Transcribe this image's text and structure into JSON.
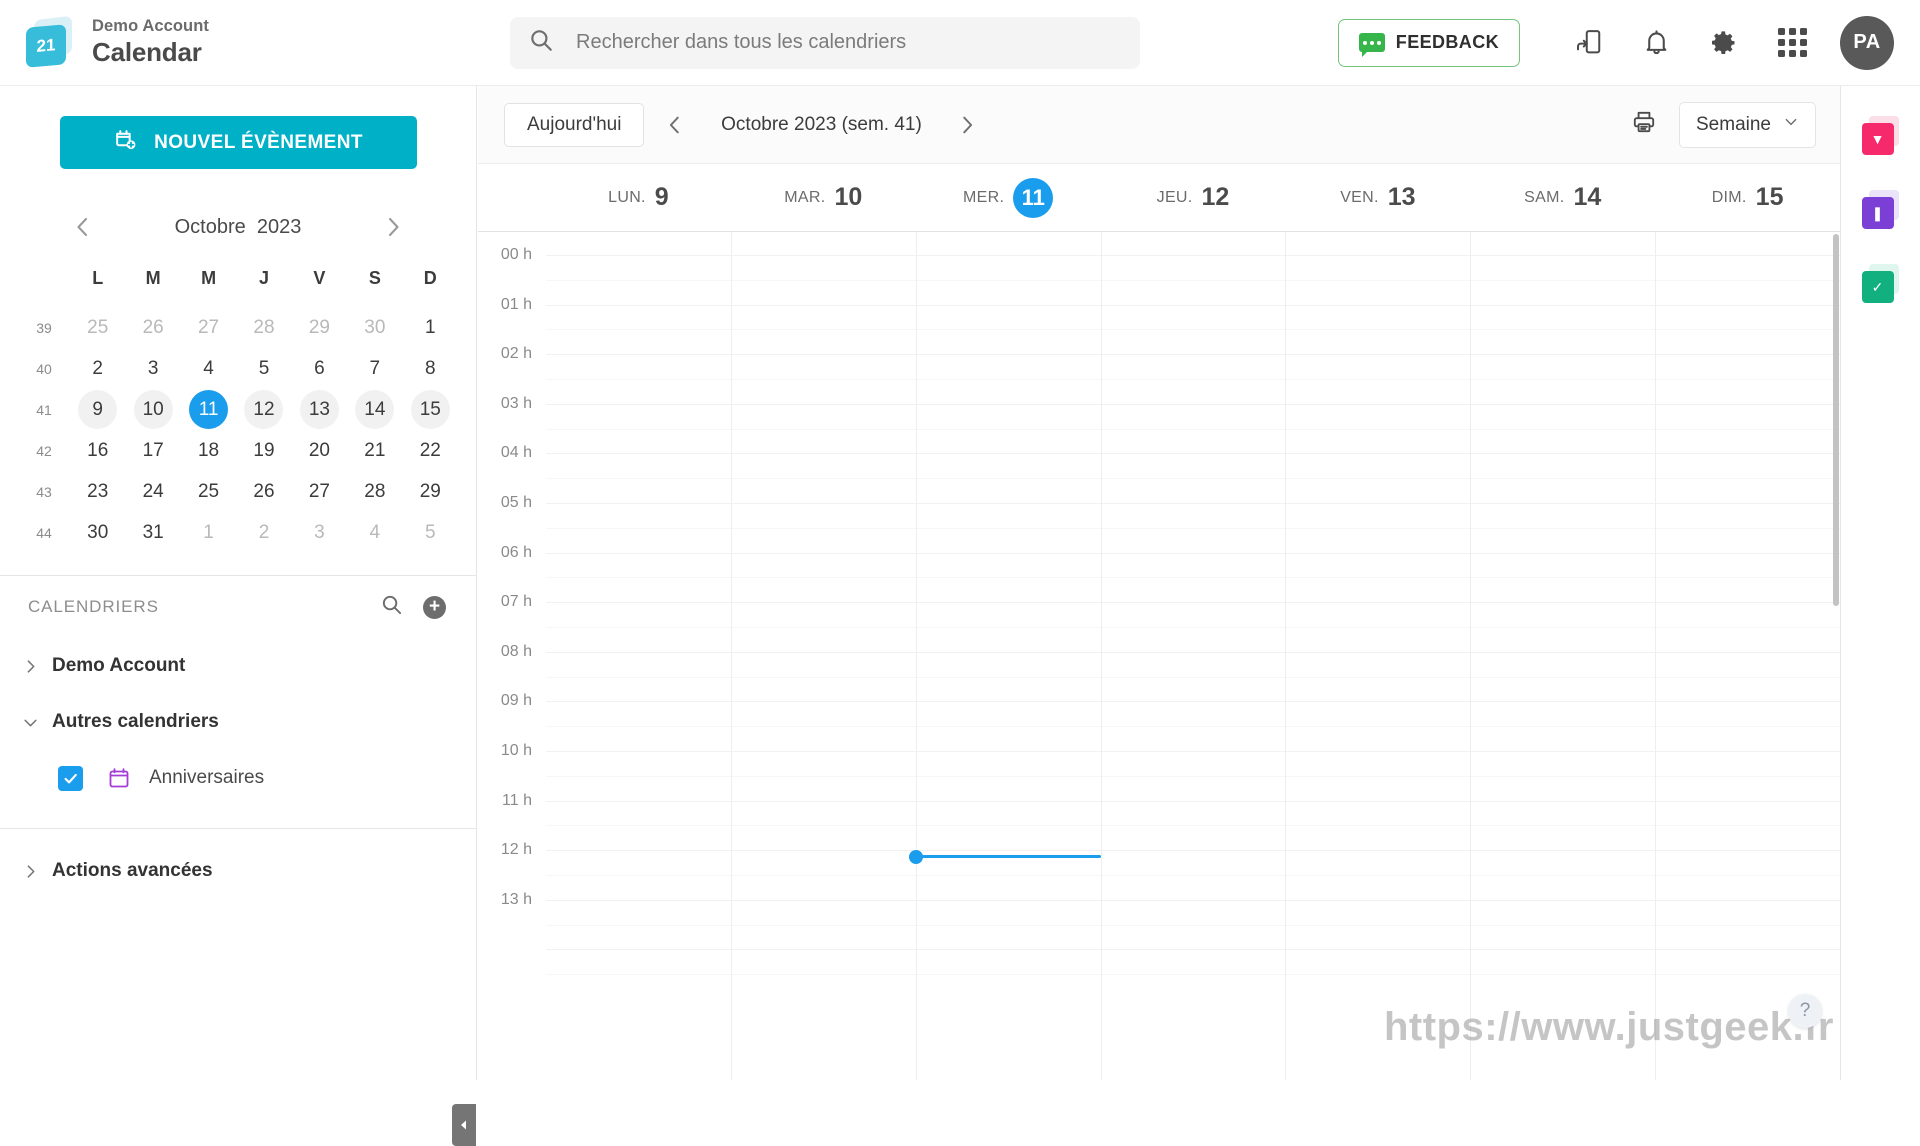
{
  "header": {
    "account": "Demo Account",
    "app_title": "Calendar",
    "logo_text": "21",
    "search_placeholder": "Rechercher dans tous les calendriers",
    "search_value": "",
    "feedback_label": "FEEDBACK",
    "avatar_initials": "PA"
  },
  "sidebar": {
    "new_event_label": "NOUVEL ÉVÈNEMENT",
    "mini_month": "Octobre",
    "mini_year": "2023",
    "weekday_headers": [
      "L",
      "M",
      "M",
      "J",
      "V",
      "S",
      "D"
    ],
    "weeks": [
      {
        "num": "39",
        "days": [
          {
            "d": "25",
            "muted": true
          },
          {
            "d": "26",
            "muted": true
          },
          {
            "d": "27",
            "muted": true
          },
          {
            "d": "28",
            "muted": true
          },
          {
            "d": "29",
            "muted": true
          },
          {
            "d": "30",
            "muted": true
          },
          {
            "d": "1",
            "muted": false
          }
        ]
      },
      {
        "num": "40",
        "days": [
          {
            "d": "2"
          },
          {
            "d": "3"
          },
          {
            "d": "4"
          },
          {
            "d": "5"
          },
          {
            "d": "6"
          },
          {
            "d": "7"
          },
          {
            "d": "8"
          }
        ]
      },
      {
        "num": "41",
        "selected": true,
        "days": [
          {
            "d": "9"
          },
          {
            "d": "10"
          },
          {
            "d": "11",
            "today": true
          },
          {
            "d": "12"
          },
          {
            "d": "13"
          },
          {
            "d": "14"
          },
          {
            "d": "15"
          }
        ]
      },
      {
        "num": "42",
        "days": [
          {
            "d": "16"
          },
          {
            "d": "17"
          },
          {
            "d": "18"
          },
          {
            "d": "19"
          },
          {
            "d": "20"
          },
          {
            "d": "21"
          },
          {
            "d": "22"
          }
        ]
      },
      {
        "num": "43",
        "days": [
          {
            "d": "23"
          },
          {
            "d": "24"
          },
          {
            "d": "25"
          },
          {
            "d": "26"
          },
          {
            "d": "27"
          },
          {
            "d": "28"
          },
          {
            "d": "29"
          }
        ]
      },
      {
        "num": "44",
        "days": [
          {
            "d": "30"
          },
          {
            "d": "31"
          },
          {
            "d": "1",
            "muted": true
          },
          {
            "d": "2",
            "muted": true
          },
          {
            "d": "3",
            "muted": true
          },
          {
            "d": "4",
            "muted": true
          },
          {
            "d": "5",
            "muted": true
          }
        ]
      }
    ],
    "calendars_section_title": "CALENDRIERS",
    "tree": [
      {
        "label": "Demo Account",
        "expanded": false
      },
      {
        "label": "Autres calendriers",
        "expanded": true
      }
    ],
    "calendar_items": [
      {
        "name": "Anniversaires",
        "checked": true,
        "color": "#a43cd6"
      }
    ],
    "advanced_actions_label": "Actions avancées"
  },
  "toolbar": {
    "today_label": "Aujourd'hui",
    "period_label": "Octobre 2023 (sem. 41)",
    "view_label": "Semaine"
  },
  "calendar": {
    "days": [
      {
        "name": "LUN.",
        "num": "9",
        "today": false
      },
      {
        "name": "MAR.",
        "num": "10",
        "today": false
      },
      {
        "name": "MER.",
        "num": "11",
        "today": true
      },
      {
        "name": "JEU.",
        "num": "12",
        "today": false
      },
      {
        "name": "VEN.",
        "num": "13",
        "today": false
      },
      {
        "name": "SAM.",
        "num": "14",
        "today": false
      },
      {
        "name": "DIM.",
        "num": "15",
        "today": false
      }
    ],
    "hours": [
      "00 h",
      "01 h",
      "02 h",
      "03 h",
      "04 h",
      "05 h",
      "06 h",
      "07 h",
      "08 h",
      "09 h",
      "10 h",
      "11 h",
      "12 h",
      "13 h"
    ],
    "now_indicator": {
      "day_index": 2,
      "hour_label": "12 h",
      "color": "#1a9ded"
    }
  },
  "rail": {
    "apps": [
      {
        "name": "mail-app",
        "back": "#f7a8c4",
        "front": "#f5296b",
        "glyph": "▼"
      },
      {
        "name": "drive-app",
        "back": "#c9b6f2",
        "front": "#7c3fd6",
        "glyph": "❚"
      },
      {
        "name": "tasks-app",
        "back": "#a8e8d2",
        "front": "#12b07e",
        "glyph": "✓"
      }
    ]
  },
  "overlay": {
    "watermark": "https://www.justgeek.fr",
    "help_glyph": "?"
  },
  "colors": {
    "accent_blue": "#1a9ded",
    "brand_teal": "#00b0c7",
    "feedback_green": "#35b54a"
  }
}
